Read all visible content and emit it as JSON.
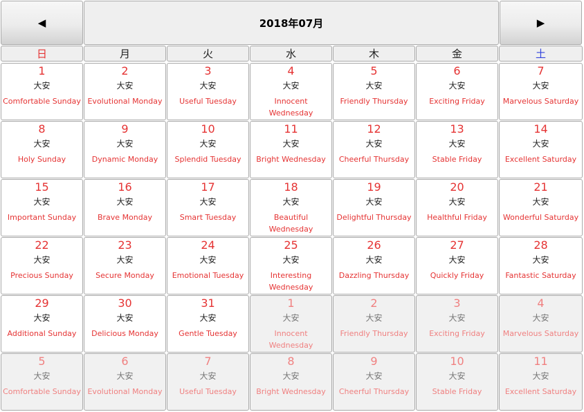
{
  "header": {
    "title": "2018年07月",
    "prev_icon": "◀",
    "next_icon": "▶"
  },
  "weekdays": [
    "日",
    "月",
    "火",
    "水",
    "木",
    "金",
    "土"
  ],
  "colors": {
    "sunday": "#e53333",
    "saturday": "#3344dd",
    "date": "#e53333",
    "other_month_date": "#f08080",
    "other_month_bg": "#f1f1f1"
  },
  "weeks": [
    [
      {
        "day": "1",
        "rokuyo": "大安",
        "label": "Comfortable Sunday",
        "other": false
      },
      {
        "day": "2",
        "rokuyo": "大安",
        "label": "Evolutional Monday",
        "other": false
      },
      {
        "day": "3",
        "rokuyo": "大安",
        "label": "Useful Tuesday",
        "other": false
      },
      {
        "day": "4",
        "rokuyo": "大安",
        "label": "Innocent Wednesday",
        "other": false
      },
      {
        "day": "5",
        "rokuyo": "大安",
        "label": "Friendly Thursday",
        "other": false
      },
      {
        "day": "6",
        "rokuyo": "大安",
        "label": "Exciting Friday",
        "other": false
      },
      {
        "day": "7",
        "rokuyo": "大安",
        "label": "Marvelous Saturday",
        "other": false
      }
    ],
    [
      {
        "day": "8",
        "rokuyo": "大安",
        "label": "Holy Sunday",
        "other": false
      },
      {
        "day": "9",
        "rokuyo": "大安",
        "label": "Dynamic Monday",
        "other": false
      },
      {
        "day": "10",
        "rokuyo": "大安",
        "label": "Splendid Tuesday",
        "other": false
      },
      {
        "day": "11",
        "rokuyo": "大安",
        "label": "Bright Wednesday",
        "other": false
      },
      {
        "day": "12",
        "rokuyo": "大安",
        "label": "Cheerful Thursday",
        "other": false
      },
      {
        "day": "13",
        "rokuyo": "大安",
        "label": "Stable Friday",
        "other": false
      },
      {
        "day": "14",
        "rokuyo": "大安",
        "label": "Excellent Saturday",
        "other": false
      }
    ],
    [
      {
        "day": "15",
        "rokuyo": "大安",
        "label": "Important Sunday",
        "other": false
      },
      {
        "day": "16",
        "rokuyo": "大安",
        "label": "Brave Monday",
        "other": false
      },
      {
        "day": "17",
        "rokuyo": "大安",
        "label": "Smart Tuesday",
        "other": false
      },
      {
        "day": "18",
        "rokuyo": "大安",
        "label": "Beautiful Wednesday",
        "other": false
      },
      {
        "day": "19",
        "rokuyo": "大安",
        "label": "Delightful Thursday",
        "other": false
      },
      {
        "day": "20",
        "rokuyo": "大安",
        "label": "Healthful Friday",
        "other": false
      },
      {
        "day": "21",
        "rokuyo": "大安",
        "label": "Wonderful Saturday",
        "other": false
      }
    ],
    [
      {
        "day": "22",
        "rokuyo": "大安",
        "label": "Precious Sunday",
        "other": false
      },
      {
        "day": "23",
        "rokuyo": "大安",
        "label": "Secure Monday",
        "other": false
      },
      {
        "day": "24",
        "rokuyo": "大安",
        "label": "Emotional Tuesday",
        "other": false
      },
      {
        "day": "25",
        "rokuyo": "大安",
        "label": "Interesting Wednesday",
        "other": false
      },
      {
        "day": "26",
        "rokuyo": "大安",
        "label": "Dazzling Thursday",
        "other": false
      },
      {
        "day": "27",
        "rokuyo": "大安",
        "label": "Quickly Friday",
        "other": false
      },
      {
        "day": "28",
        "rokuyo": "大安",
        "label": "Fantastic Saturday",
        "other": false
      }
    ],
    [
      {
        "day": "29",
        "rokuyo": "大安",
        "label": "Additional Sunday",
        "other": false
      },
      {
        "day": "30",
        "rokuyo": "大安",
        "label": "Delicious Monday",
        "other": false
      },
      {
        "day": "31",
        "rokuyo": "大安",
        "label": "Gentle Tuesday",
        "other": false
      },
      {
        "day": "1",
        "rokuyo": "大安",
        "label": "Innocent Wednesday",
        "other": true
      },
      {
        "day": "2",
        "rokuyo": "大安",
        "label": "Friendly Thursday",
        "other": true
      },
      {
        "day": "3",
        "rokuyo": "大安",
        "label": "Exciting Friday",
        "other": true
      },
      {
        "day": "4",
        "rokuyo": "大安",
        "label": "Marvelous Saturday",
        "other": true
      }
    ],
    [
      {
        "day": "5",
        "rokuyo": "大安",
        "label": "Comfortable Sunday",
        "other": true
      },
      {
        "day": "6",
        "rokuyo": "大安",
        "label": "Evolutional Monday",
        "other": true
      },
      {
        "day": "7",
        "rokuyo": "大安",
        "label": "Useful Tuesday",
        "other": true
      },
      {
        "day": "8",
        "rokuyo": "大安",
        "label": "Bright Wednesday",
        "other": true
      },
      {
        "day": "9",
        "rokuyo": "大安",
        "label": "Cheerful Thursday",
        "other": true
      },
      {
        "day": "10",
        "rokuyo": "大安",
        "label": "Stable Friday",
        "other": true
      },
      {
        "day": "11",
        "rokuyo": "大安",
        "label": "Excellent Saturday",
        "other": true
      }
    ]
  ]
}
